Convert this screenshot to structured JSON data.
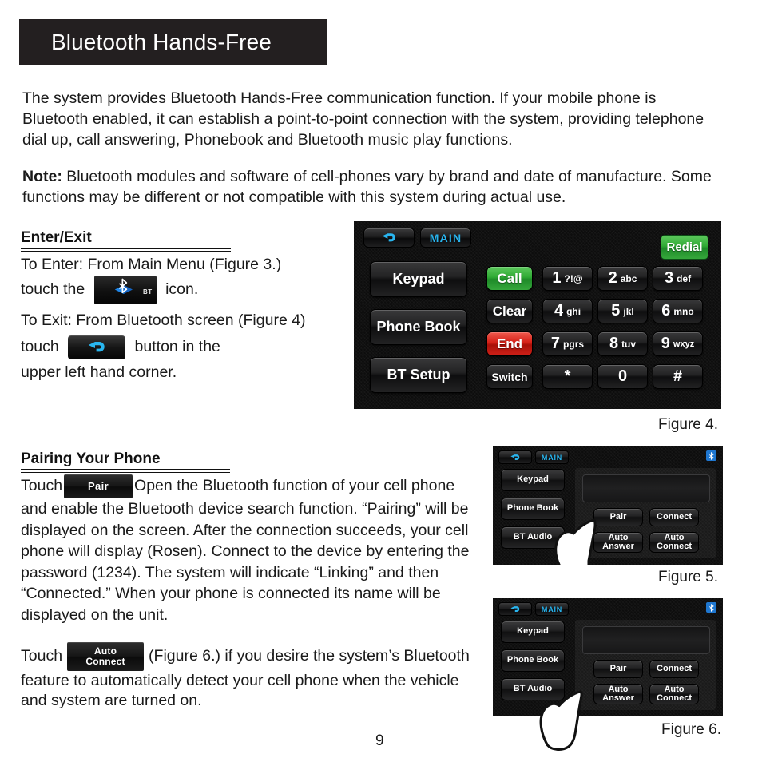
{
  "document": {
    "title": "Bluetooth Hands-Free",
    "page_number": "9"
  },
  "intro_paragraph": "The system provides Bluetooth Hands-Free communication function.  If your mobile phone is Bluetooth enabled, it can establish a point-to-point connection with the system, providing telephone dial up, call answering, Phonebook and Bluetooth music play functions.",
  "note": {
    "label": "Note:",
    "text": " Bluetooth modules and software of cell-phones vary by brand and date of manufacture. Some functions may be different or not compatible with this system during actual use."
  },
  "sections": {
    "enter_exit": {
      "heading": "Enter/Exit",
      "enter_text_before": "To Enter:  From Main Menu (Figure 3.)",
      "enter_text_mid": "touch the",
      "enter_text_after": "icon.",
      "bt_button_label": "BT",
      "exit_text_before": "To Exit:  From Bluetooth screen (Figure 4)",
      "exit_text_mid": "touch",
      "exit_text_after": "button in the",
      "exit_text_last": "upper left hand corner."
    },
    "pairing": {
      "heading": "Pairing Your Phone",
      "touch_label": "Touch",
      "pair_button_label": "Pair",
      "pair_text": "Open the Bluetooth function of your cell phone and enable the Bluetooth device search function. “Pairing” will be displayed on the screen.  After the connection succeeds, your cell phone will display (Rosen). Connect to the device by entering the password (1234). The system will indicate “Linking” and then “Connected.”  When your phone is connected its name will be displayed on the unit.",
      "auto_touch_label": "Touch",
      "auto_connect_line1": "Auto",
      "auto_connect_line2": "Connect",
      "auto_text": "(Figure 6.) if you desire the system’s Bluetooth feature to automatically detect your cell phone when the vehicle and system are turned on."
    }
  },
  "figure4": {
    "caption": "Figure 4.",
    "back_icon": "back-arrow-icon",
    "main_label": "MAIN",
    "redial_label": "Redial",
    "side_buttons": [
      "Keypad",
      "Phone Book",
      "BT Setup"
    ],
    "action_column": [
      "Call",
      "Clear",
      "End",
      "Switch"
    ],
    "keys": [
      {
        "num": "1",
        "sub": "?!@"
      },
      {
        "num": "2",
        "sub": "abc"
      },
      {
        "num": "3",
        "sub": "def"
      },
      {
        "num": "4",
        "sub": "ghi"
      },
      {
        "num": "5",
        "sub": "jkl"
      },
      {
        "num": "6",
        "sub": "mno"
      },
      {
        "num": "7",
        "sub": "pgrs"
      },
      {
        "num": "8",
        "sub": "tuv"
      },
      {
        "num": "9",
        "sub": "wxyz"
      },
      {
        "num": "*",
        "sub": ""
      },
      {
        "num": "0",
        "sub": ""
      },
      {
        "num": "#",
        "sub": ""
      }
    ]
  },
  "figure5": {
    "caption": "Figure 5.",
    "back_icon": "back-arrow-icon",
    "main_label": "MAIN",
    "bt_status_icon": "bluetooth-icon",
    "side_buttons": [
      "Keypad",
      "Phone Book",
      "BT Audio"
    ],
    "panel_buttons": [
      "Pair",
      "Connect",
      "Auto\nAnswer",
      "Auto\nConnect"
    ],
    "pair_label": "Pair",
    "connect_label": "Connect",
    "auto_answer_line1": "Auto",
    "auto_answer_line2": "Answer",
    "auto_connect_line1": "Auto",
    "auto_connect_line2": "Connect",
    "pointer_target": "Pair"
  },
  "figure6": {
    "caption": "Figure 6.",
    "back_icon": "back-arrow-icon",
    "main_label": "MAIN",
    "bt_status_icon": "bluetooth-icon",
    "side_buttons": [
      "Keypad",
      "Phone Book",
      "BT Audio"
    ],
    "pair_label": "Pair",
    "connect_label": "Connect",
    "auto_answer_line1": "Auto",
    "auto_answer_line2": "Answer",
    "auto_connect_line1": "Auto",
    "auto_connect_line2": "Connect",
    "pointer_target": "Auto Connect"
  },
  "colors": {
    "title_bar_bg": "#231f20",
    "accent_cyan": "#27b4ee",
    "call_green": "#2faa34",
    "end_red": "#d41f16",
    "bluetooth_blue": "#1f77d0",
    "paper_bg": "#ffffff"
  }
}
